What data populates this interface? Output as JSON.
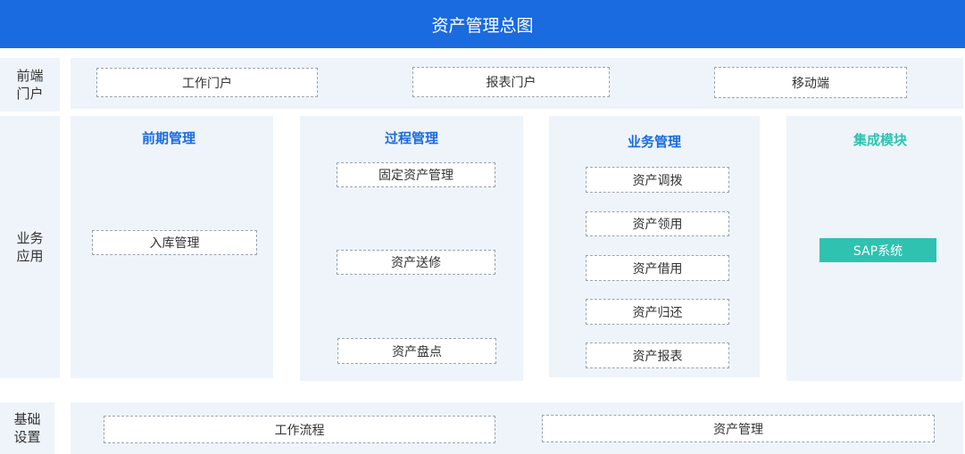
{
  "title": "资产管理总图",
  "rows": {
    "frontend": {
      "label": "前端门户",
      "items": [
        "工作门户",
        "报表门户",
        "移动端"
      ]
    },
    "business": {
      "label": "业务应用"
    },
    "base": {
      "label": "基础设置",
      "items": [
        "工作流程",
        "资产管理"
      ]
    }
  },
  "columns": [
    {
      "title": "前期管理",
      "items": [
        "入库管理"
      ]
    },
    {
      "title": "过程管理",
      "items": [
        "固定资产管理",
        "资产送修",
        "资产盘点"
      ]
    },
    {
      "title": "业务管理",
      "items": [
        "资产调拨",
        "资产领用",
        "资产借用",
        "资产归还",
        "资产报表"
      ]
    },
    {
      "title": "集成模块",
      "items": [
        "SAP系统"
      ]
    }
  ],
  "colors": {
    "primary": "#1a6ae0",
    "teal": "#2fc2b0",
    "panel": "#eef4fa"
  }
}
